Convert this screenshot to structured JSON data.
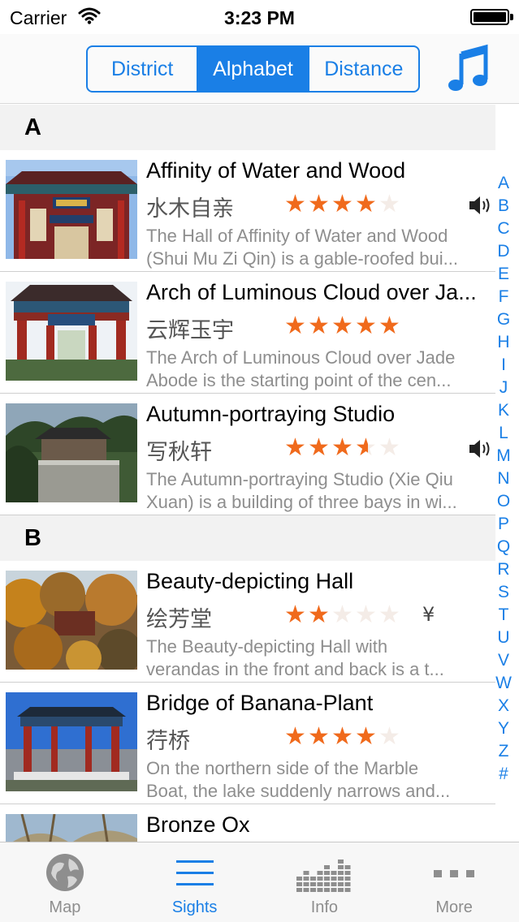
{
  "status_bar": {
    "carrier": "Carrier",
    "time": "3:23 PM"
  },
  "nav": {
    "segments": [
      "District",
      "Alphabet",
      "Distance"
    ],
    "selected": "Alphabet",
    "accent_color": "#1a7fe6",
    "music_icon": "music-note-icon"
  },
  "sections": [
    {
      "letter": "A",
      "rows": [
        {
          "title": "Affinity of Water and Wood",
          "chinese": "水木自亲",
          "rating": 4,
          "audio": true,
          "desc1": "The Hall of Affinity of Water and Wood",
          "desc2": "(Shui Mu Zi Qin) is a gable-roofed bui..."
        },
        {
          "title": "Arch of Luminous Cloud over Ja...",
          "chinese": "云辉玉宇",
          "rating": 5,
          "audio": false,
          "desc1": "The Arch of Luminous Cloud over Jade",
          "desc2": "Abode is the starting point of the cen..."
        },
        {
          "title": "Autumn-portraying Studio",
          "chinese": "写秋轩",
          "rating": 3.5,
          "audio": true,
          "desc1": "The Autumn-portraying Studio (Xie Qiu",
          "desc2": "Xuan) is a building of three bays in wi..."
        }
      ]
    },
    {
      "letter": "B",
      "rows": [
        {
          "title": "Beauty-depicting Hall",
          "chinese": "绘芳堂",
          "rating": 2,
          "fee": "¥",
          "desc1": "The Beauty-depicting Hall with",
          "desc2": "verandas in the front and back is a t..."
        },
        {
          "title": "Bridge of Banana-Plant",
          "chinese": "荇桥",
          "rating": 4,
          "desc1": "On the northern side of the Marble",
          "desc2": "Boat, the lake suddenly narrows and..."
        },
        {
          "title": "Bronze Ox"
        }
      ]
    }
  ],
  "index": [
    "A",
    "B",
    "C",
    "D",
    "E",
    "F",
    "G",
    "H",
    "I",
    "J",
    "K",
    "L",
    "M",
    "N",
    "O",
    "P",
    "Q",
    "R",
    "S",
    "T",
    "U",
    "V",
    "W",
    "X",
    "Y",
    "Z",
    "#"
  ],
  "tabs": [
    {
      "label": "Map",
      "icon": "globe-icon",
      "active": false
    },
    {
      "label": "Sights",
      "icon": "list-icon",
      "active": true
    },
    {
      "label": "Info",
      "icon": "equalizer-icon",
      "active": false
    },
    {
      "label": "More",
      "icon": "more-dots-icon",
      "active": false
    }
  ]
}
